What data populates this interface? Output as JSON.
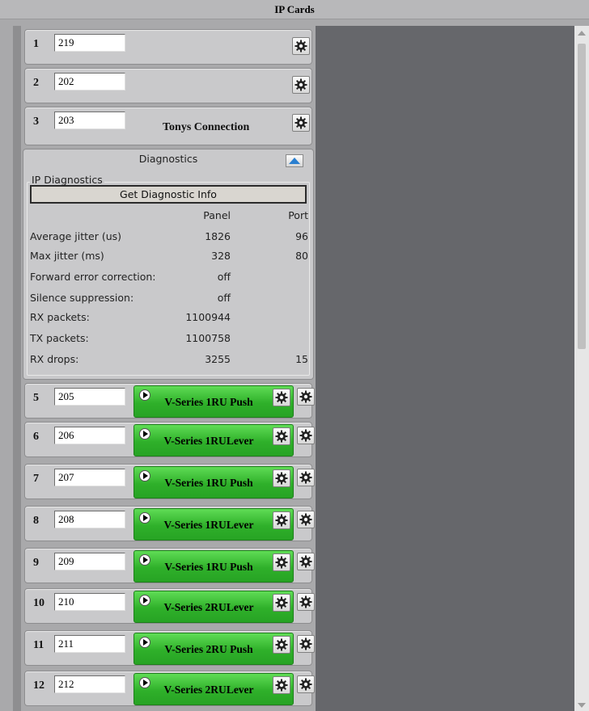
{
  "window": {
    "title": "IP Cards"
  },
  "cards_top": [
    {
      "num": "1",
      "value": "219",
      "name": ""
    },
    {
      "num": "2",
      "value": "202",
      "name": ""
    },
    {
      "num": "3",
      "value": "203",
      "name": "Tonys Connection"
    }
  ],
  "diagnostics": {
    "header": "Diagnostics",
    "group_title": "IP Diagnostics",
    "button_label": "Get Diagnostic Info",
    "col_panel": "Panel",
    "col_port": "Port",
    "rows": [
      {
        "label": "Average jitter (us)",
        "panel": "1826",
        "port": "96"
      },
      {
        "label": "Max jitter (ms)",
        "panel": "328",
        "port": "80"
      },
      {
        "label": "Forward error correction:",
        "panel": "off",
        "port": ""
      },
      {
        "label": "Silence suppression:",
        "panel": "off",
        "port": ""
      },
      {
        "label": "RX packets:",
        "panel": "1100944",
        "port": ""
      },
      {
        "label": "TX packets:",
        "panel": "1100758",
        "port": ""
      },
      {
        "label": "RX drops:",
        "panel": "3255",
        "port": "15"
      }
    ]
  },
  "cards_bottom": [
    {
      "num": "5",
      "value": "205",
      "panel_line1": "V-Series 1RU Push",
      "panel_line2": ""
    },
    {
      "num": "6",
      "value": "206",
      "panel_line1": "V-Series 1RU",
      "panel_line2": "Lever"
    },
    {
      "num": "7",
      "value": "207",
      "panel_line1": "V-Series 1RU Push",
      "panel_line2": ""
    },
    {
      "num": "8",
      "value": "208",
      "panel_line1": "V-Series 1RU",
      "panel_line2": "Lever"
    },
    {
      "num": "9",
      "value": "209",
      "panel_line1": "V-Series 1RU Push",
      "panel_line2": ""
    },
    {
      "num": "10",
      "value": "210",
      "panel_line1": "V-Series 2RU",
      "panel_line2": "Lever"
    },
    {
      "num": "11",
      "value": "211",
      "panel_line1": "V-Series 2RU Push",
      "panel_line2": ""
    },
    {
      "num": "12",
      "value": "212",
      "panel_line1": "V-Series 2RU",
      "panel_line2": "Lever"
    }
  ],
  "icons": {
    "gear": "gear-icon",
    "play": "play-icon",
    "collapse": "chevron-up-icon"
  },
  "colors": {
    "green_button": "#2fb02a",
    "dark_area": "#66676b",
    "card_bg": "#c9c9cb"
  }
}
